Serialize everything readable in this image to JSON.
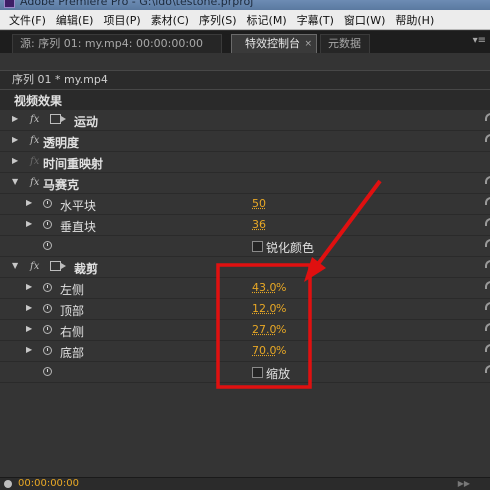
{
  "title": {
    "text": "Adobe Premiere Pro - G:\\ido\\testone.prproj"
  },
  "menu": [
    "文件(F)",
    "编辑(E)",
    "项目(P)",
    "素材(C)",
    "序列(S)",
    "标记(M)",
    "字幕(T)",
    "窗口(W)",
    "帮助(H)"
  ],
  "tabs": {
    "source": "源: 序列 01: my.mp4: 00:00:00:00",
    "effect_controls": "特效控制台",
    "close": "×",
    "metadata": "元数据",
    "menu_glyph": "▾≡"
  },
  "panel": {
    "sequence": "序列 01 * my.mp4",
    "video_effects": "视频效果",
    "fx": "fx",
    "effects": {
      "motion": "运动",
      "opacity": "透明度",
      "time_remap": "时间重映射",
      "mosaic": {
        "name": "马赛克",
        "horizontal_blocks": {
          "label": "水平块",
          "value": "50"
        },
        "vertical_blocks": {
          "label": "垂直块",
          "value": "36"
        },
        "sharpen": {
          "label": "锐化颜色",
          "checked": false
        }
      },
      "crop": {
        "name": "裁剪",
        "left": {
          "label": "左侧",
          "value": "43.0",
          "unit": "%"
        },
        "top": {
          "label": "顶部",
          "value": "12.0",
          "unit": "%"
        },
        "right": {
          "label": "右侧",
          "value": "27.0",
          "unit": "%"
        },
        "bottom": {
          "label": "底部",
          "value": "70.0",
          "unit": "%"
        },
        "zoom": {
          "label": "缩放",
          "checked": false
        }
      }
    }
  },
  "timecode": "00:00:00:00",
  "colors": {
    "value": "#e8a825",
    "annotation": "#e01010",
    "panel": "#343434"
  },
  "icons": [
    "expand-triangle-icon",
    "fx-icon",
    "motion-icon",
    "stopwatch-icon",
    "reset-icon",
    "play-icon",
    "close-icon"
  ]
}
